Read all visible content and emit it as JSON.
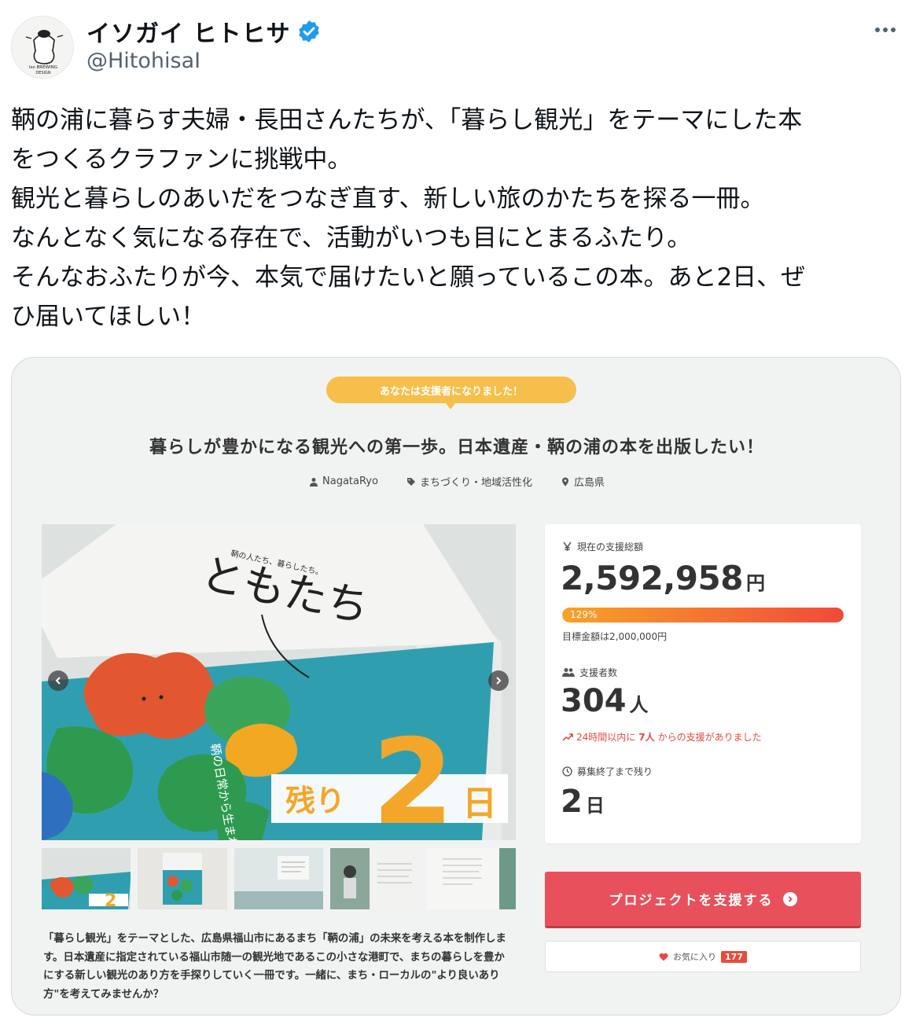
{
  "tweet": {
    "author_name": "イソガイ ヒトヒサ",
    "author_handle": "@HitohisaI",
    "text": "鞆の浦に暮らす夫婦・長田さんたちが、「暮らし観光」をテーマにした本\nをつくるクラファンに挑戦中。\n観光と暮らしのあいだをつなぎ直す、新しい旅のかたちを探る一冊。\nなんとなく気になる存在で、活動がいつも目にとまるふたり。\nそんなおふたりが今、本気で届けたいと願っているこの本。あと2日、ぜ\nひ届いてほしい！",
    "avatar_text": [
      "Iso BREWING",
      "DESIGN"
    ]
  },
  "card": {
    "supporter_badge": "あなたは支援者になりました！",
    "project_title": "暮らしが豊かになる観光への第一歩。日本遺産・鞆の浦の本を出版したい！",
    "meta": {
      "owner": "NagataRyo",
      "category": "まちづくり・地域活性化",
      "location": "広島県"
    },
    "image": {
      "book_title": "ともたち",
      "book_subtitle": "鞆の人たち、暮らしたち。",
      "book_tagline": "鞆の日常から生まれる暮らし観光。",
      "countdown_prefix": "残り",
      "countdown_number": "2",
      "countdown_suffix": "日"
    },
    "description": "「暮らし観光」をテーマとした、広島県福山市にあるまち「鞆の浦」の未来を考える本を制作します。日本遺産に指定されている福山市随一の観光地であるこの小さな港町で、まちの暮らしを豊かにする新しい観光のあり方を手探りしていく一冊です。一緒に、まち・ローカルの\"より良いあり方\"を考えてみませんか？",
    "stats": {
      "total_label": "現在の支援総額",
      "total_amount": "2,592,958",
      "total_unit": "円",
      "progress_percent": 129,
      "progress_text": "129%",
      "goal_text": "目標金額は2,000,000円",
      "backers_label": "支援者数",
      "backers_count": "304",
      "backers_unit": "人",
      "recent_prefix": "24時間以内に",
      "recent_count": "7人",
      "recent_suffix": "からの支援がありました",
      "remaining_label": "募集終了まで残り",
      "remaining_value": "2",
      "remaining_unit": "日"
    },
    "support_button": "プロジェクトを支援する",
    "favorite_label": "お気に入り",
    "favorite_count": "177"
  },
  "colors": {
    "verified": "#1d9bf0",
    "accent_red": "#e8515b",
    "badge_yellow": "#f6bf4c",
    "book_teal": "#2a9fb0"
  }
}
